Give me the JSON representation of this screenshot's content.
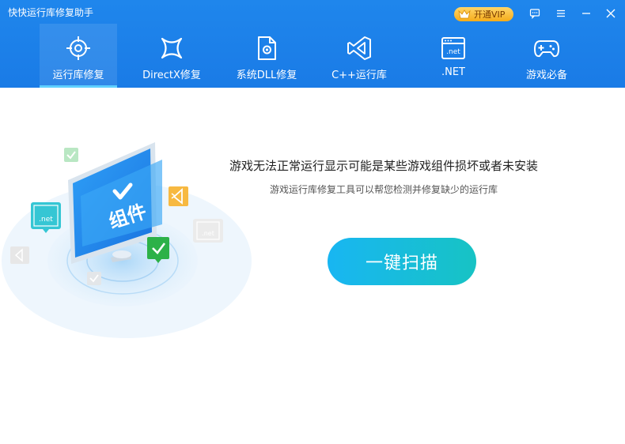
{
  "app": {
    "title": "快快运行库修复助手"
  },
  "header": {
    "vip_label": "开通VIP",
    "window_controls": [
      "feedback-icon",
      "menu-icon",
      "minimize-icon",
      "close-icon"
    ]
  },
  "tabs": [
    {
      "label": "运行库修复",
      "icon": "target-icon",
      "active": true
    },
    {
      "label": "DirectX修复",
      "icon": "directx-icon",
      "active": false
    },
    {
      "label": "系统DLL修复",
      "icon": "dll-file-icon",
      "active": false
    },
    {
      "label": "C++运行库",
      "icon": "visual-studio-icon",
      "active": false
    },
    {
      "label": ".NET",
      "icon": "dotnet-window-icon",
      "active": false
    },
    {
      "label": "游戏必备",
      "icon": "gamepad-icon",
      "active": false
    }
  ],
  "illustration": {
    "screen_text": "组件",
    "badge_net": ".net",
    "badge_net_faded": ".net"
  },
  "main": {
    "headline": "游戏无法正常运行显示可能是某些游戏组件损坏或者未安装",
    "subline": "游戏运行库修复工具可以帮您检测并修复缺少的运行库",
    "scan_button": "一键扫描"
  },
  "colors": {
    "header_blue": "#1a7be6",
    "vip_gold": "#f5ab1a",
    "scan_start": "#18b6f2",
    "scan_end": "#17c3c4",
    "active_underline": "#5fd0ff"
  }
}
